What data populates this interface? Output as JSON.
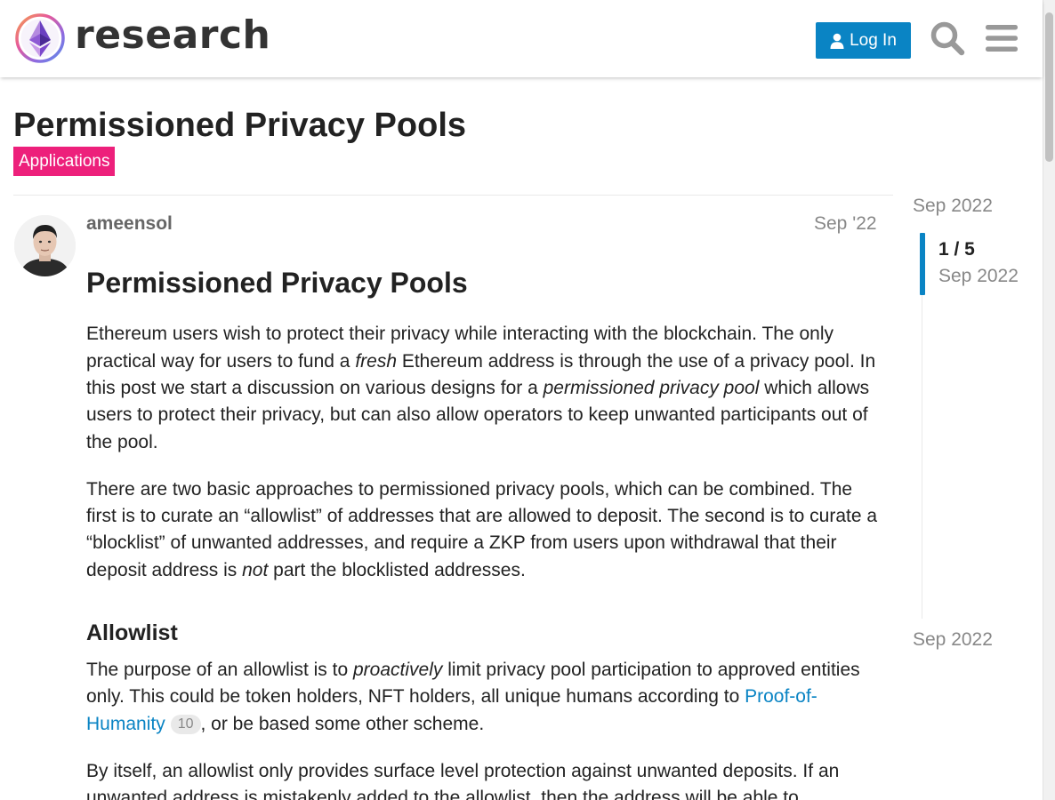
{
  "header": {
    "site_name": "research",
    "login_label": "Log In"
  },
  "topic": {
    "title": "Permissioned Privacy Pools",
    "category": "Applications",
    "category_color": "#ed207b"
  },
  "post": {
    "username": "ameensol",
    "date": "Sep '22",
    "heading": "Permissioned Privacy Pools",
    "p1": {
      "a": "Ethereum users wish to protect their privacy while interacting with the blockchain. The only practical way for users to fund a ",
      "em1": "fresh",
      "b": " Ethereum address is through the use of a privacy pool. In this post we start a discussion on various designs for a ",
      "em2": "permissioned privacy pool",
      "c": " which allows users to protect their privacy, but can also allow operators to keep unwanted participants out of the pool."
    },
    "p2": {
      "a": "There are two basic approaches to permissioned privacy pools, which can be combined. The first is to curate an “allowlist” of addresses that are allowed to deposit. The second is to curate a “blocklist” of unwanted addresses, and require a ZKP from users upon withdrawal that their deposit address is ",
      "em": "not",
      "b": " part the blocklisted addresses."
    },
    "section_heading": "Allowlist",
    "p3": {
      "a": "The purpose of an allowlist is to ",
      "em": "proactively",
      "b": " limit privacy pool participation to approved entities only. This could be token holders, NFT holders, all unique humans according to ",
      "link": "Proof-of-Humanity",
      "clicks": "10",
      "c": ", or be based some other scheme."
    },
    "p4": "By itself, an allowlist only provides surface level protection against unwanted deposits. If an unwanted address is mistakenly added to the allowlist, then the address will be able to"
  },
  "timeline": {
    "top_date": "Sep 2022",
    "position": "1 / 5",
    "position_date": "Sep 2022",
    "bottom_date": "Sep 2022"
  },
  "colors": {
    "accent": "#0a84c4",
    "category": "#ed207b"
  }
}
